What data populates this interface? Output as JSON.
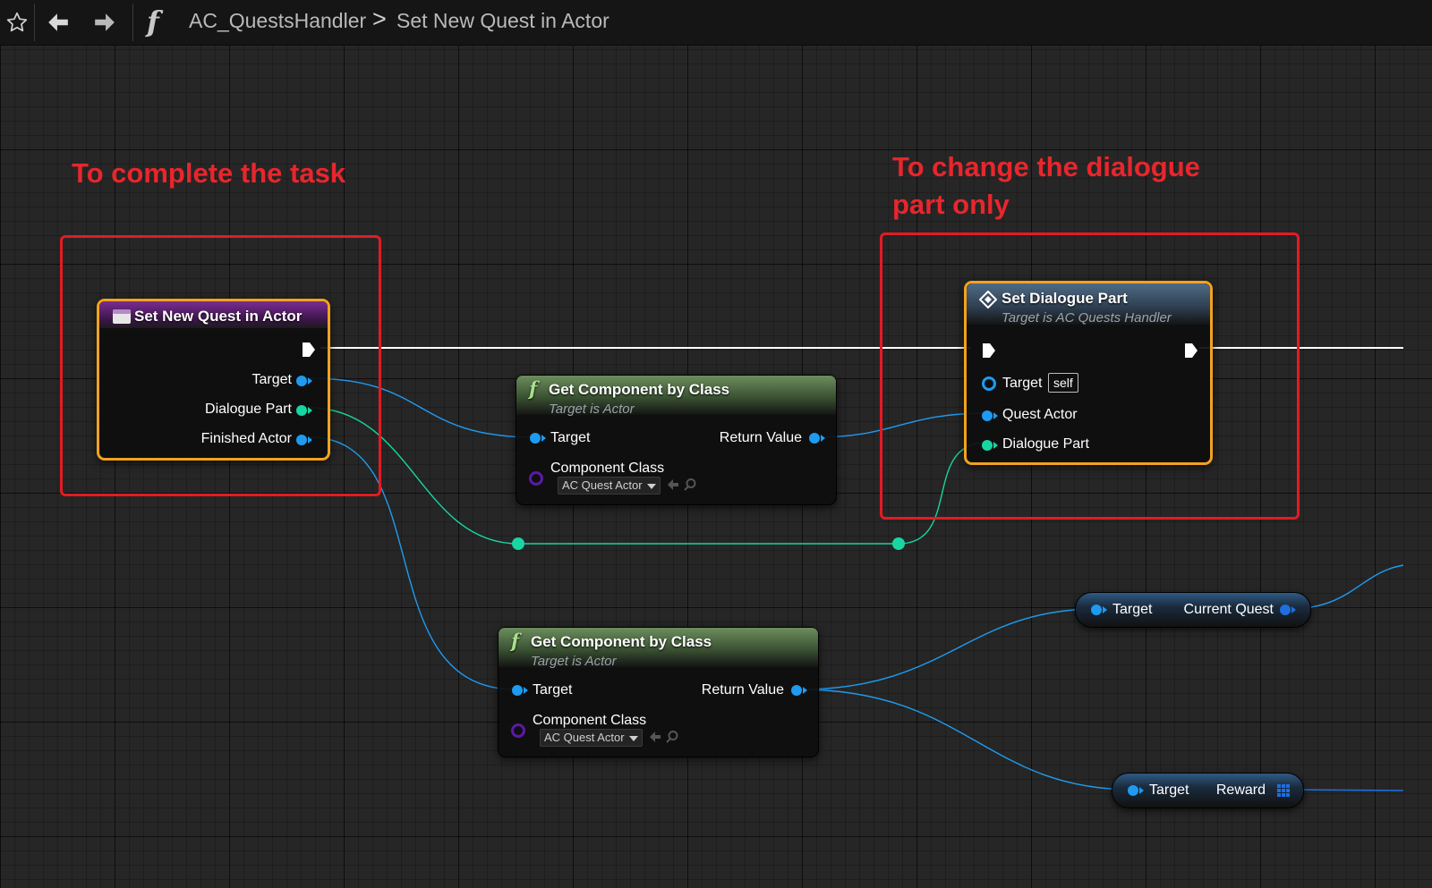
{
  "toolbar": {
    "favorite_icon": "star-outline-icon",
    "back_icon": "arrow-left-icon",
    "forward_icon": "arrow-right-icon",
    "function_icon": "f",
    "breadcrumb": {
      "blueprint": "AC_QuestsHandler",
      "separator": ">",
      "function": "Set New Quest in Actor"
    }
  },
  "annotations": {
    "left": "To complete the task",
    "right_line1": "To change the dialogue",
    "right_line2": "part only",
    "color": "#e31b23"
  },
  "nodes": {
    "entry": {
      "title": "Set New Quest in Actor",
      "pins": {
        "target": "Target",
        "dialogue_part": "Dialogue Part",
        "finished_actor": "Finished Actor"
      }
    },
    "get_component_1": {
      "icon": "f",
      "title": "Get Component by Class",
      "subtitle": "Target is Actor",
      "pins": {
        "target": "Target",
        "return_value": "Return Value",
        "component_class": "Component Class"
      },
      "class_value": "AC Quest Actor"
    },
    "get_component_2": {
      "icon": "f",
      "title": "Get Component by Class",
      "subtitle": "Target is Actor",
      "pins": {
        "target": "Target",
        "return_value": "Return Value",
        "component_class": "Component Class"
      },
      "class_value": "AC Quest Actor"
    },
    "set_dialogue_part": {
      "title": "Set Dialogue Part",
      "subtitle": "Target is AC Quests Handler",
      "pins": {
        "target": "Target",
        "target_default": "self",
        "quest_actor": "Quest Actor",
        "dialogue_part": "Dialogue Part"
      }
    },
    "get_current_quest": {
      "target": "Target",
      "output": "Current Quest"
    },
    "get_reward": {
      "target": "Target",
      "output": "Reward"
    }
  },
  "colors": {
    "selection_outline": "#f2a21f",
    "object_pin": "#1e9bf0",
    "struct_pin": "#17d6a1",
    "class_pin": "#5a1aa6",
    "exec_wire": "#ffffff"
  }
}
